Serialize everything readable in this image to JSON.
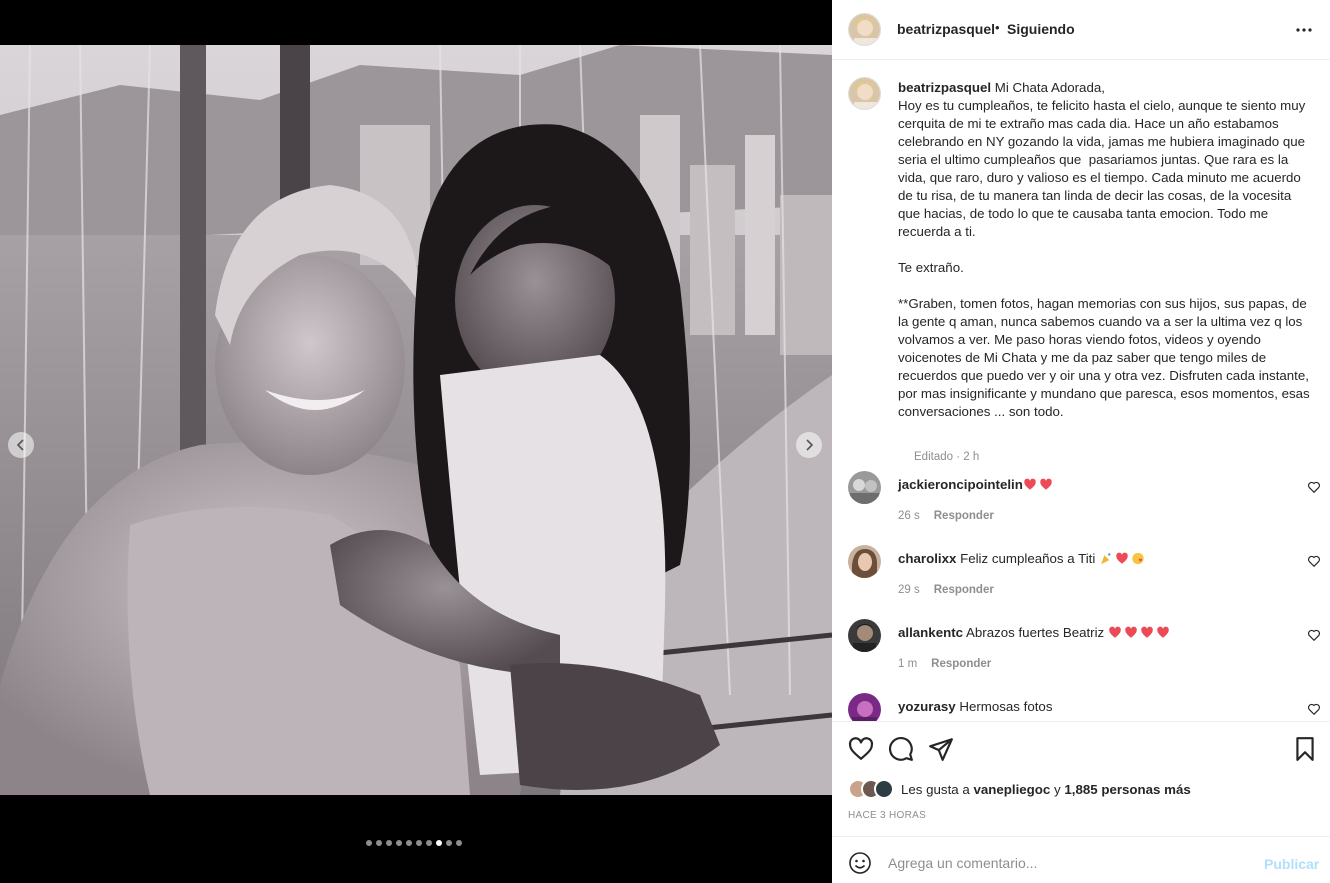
{
  "post": {
    "username": "beatrizpasquel",
    "separator": "•",
    "follow_status": "Siguiendo",
    "caption_text": " Mi Chata Adorada,\nHoy es tu cumpleaños, te felicito hasta el cielo, aunque te siento muy cerquita de mi te extraño mas cada dia. Hace un año estabamos celebrando en NY gozando la vida, jamas me hubiera imaginado que seria el ultimo cumpleaños que  pasariamos juntas. Que rara es la vida, que raro, duro y valioso es el tiempo. Cada minuto me acuerdo de tu risa, de tu manera tan linda de decir las cosas, de la vocesita que hacias, de todo lo que te causaba tanta emocion. Todo me recuerda a ti.\n\nTe extraño.\n\n**Graben, tomen fotos, hagan memorias con sus hijos, sus papas, de la gente q aman, nunca sabemos cuando va a ser la ultima vez q los volvamos a ver. Me paso horas viendo fotos, videos y oyendo voicenotes de Mi Chata y me da paz saber que tengo miles de recuerdos que puedo ver y oir una y otra vez. Disfruten cada instante, por mas insignificante y mundano que paresca, esos momentos, esas conversaciones ... son todo.",
    "edited_label": "Editado · 2 h",
    "carousel": {
      "total": 10,
      "active_index": 7
    }
  },
  "comments": [
    {
      "username": "jackieroncipointelin",
      "text": "",
      "emojis": [
        "heart",
        "heart"
      ],
      "time": "26 s",
      "reply": "Responder"
    },
    {
      "username": "charolixx",
      "text": " Feliz cumpleaños a Titi ",
      "emojis": [
        "party",
        "heart",
        "kiss"
      ],
      "time": "29 s",
      "reply": "Responder"
    },
    {
      "username": "allankentc",
      "text": " Abrazos fuertes Beatriz ",
      "emojis": [
        "heart",
        "heart",
        "heart",
        "heart"
      ],
      "time": "1 m",
      "reply": "Responder"
    },
    {
      "username": "yozurasy",
      "text": " Hermosas fotos",
      "emojis": [],
      "time": "",
      "reply": ""
    }
  ],
  "likes": {
    "prefix": "Les gusta a ",
    "user": "vanepliegoc",
    "middle": " y ",
    "others": "1,885 personas más"
  },
  "time_ago": "HACE 3 HORAS",
  "composer": {
    "placeholder": "Agrega un comentario...",
    "publish": "Publicar"
  },
  "colors": {
    "heart_red": "#ed4956",
    "link_disabled": "#b2dffc",
    "muted": "#8e8e8e",
    "text": "#262626"
  },
  "icons": [
    "more-icon",
    "heart-icon",
    "comment-icon",
    "share-icon",
    "bookmark-icon",
    "emoji-icon",
    "chevron-left-icon",
    "chevron-right-icon"
  ]
}
